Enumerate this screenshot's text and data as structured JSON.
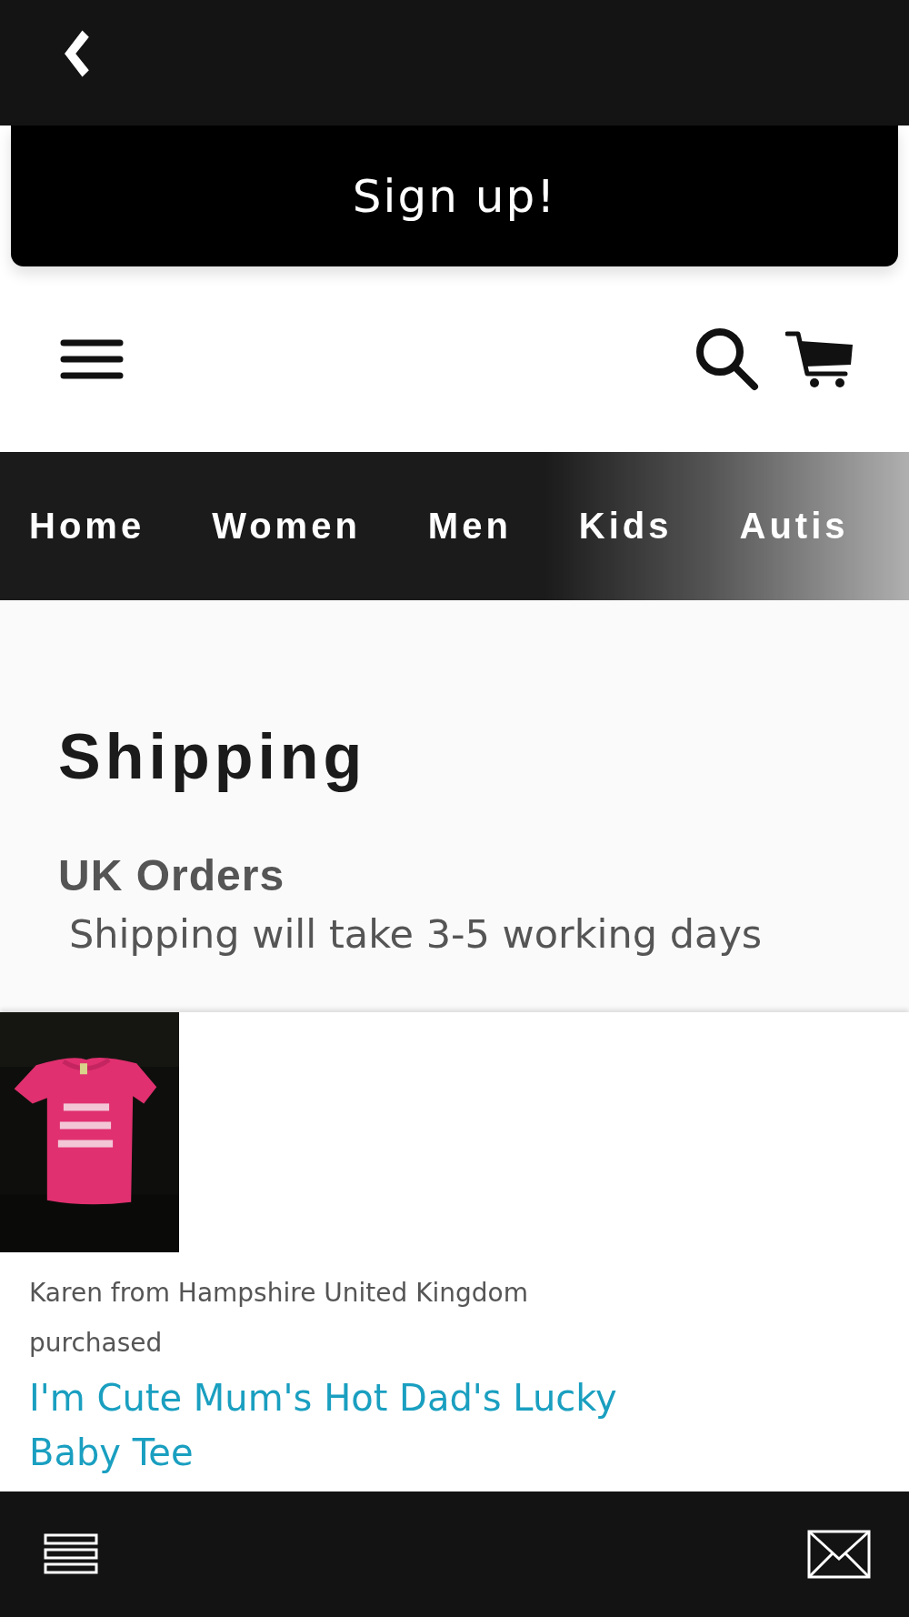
{
  "signup_banner": {
    "label": "Sign up!"
  },
  "nav": {
    "items": [
      {
        "label": "Home"
      },
      {
        "label": "Women"
      },
      {
        "label": "Men"
      },
      {
        "label": "Kids"
      },
      {
        "label": "Autis"
      }
    ]
  },
  "page": {
    "title": "Shipping",
    "sections": [
      {
        "heading": "UK Orders",
        "text": "Shipping will take 3-5 working days"
      }
    ]
  },
  "purchase_popup": {
    "customer": "Karen from Hampshire United Kingdom",
    "action": "purchased",
    "product": "I'm Cute Mum's Hot Dad's Lucky Baby Tee"
  }
}
